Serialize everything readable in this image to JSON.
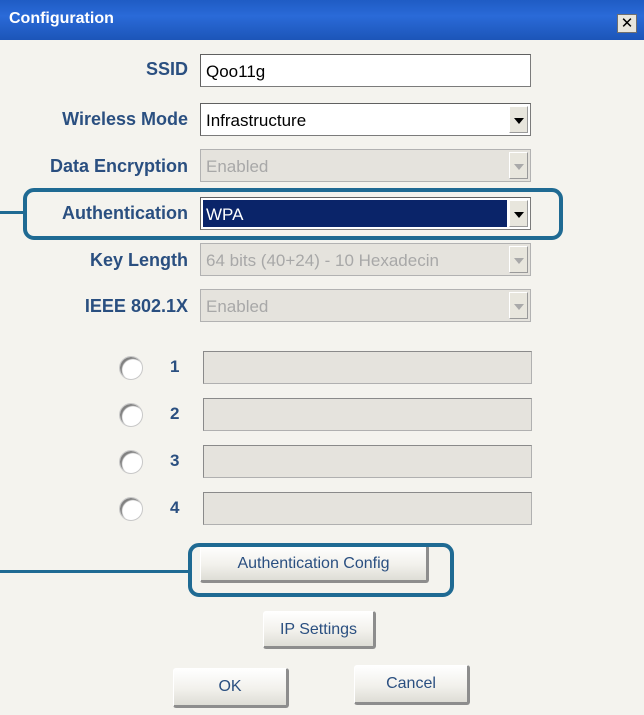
{
  "window": {
    "title": "Configuration",
    "close_glyph": "✕"
  },
  "form": {
    "ssid": {
      "label": "SSID",
      "value": "Qoo11g"
    },
    "wireless_mode": {
      "label": "Wireless Mode",
      "value": "Infrastructure"
    },
    "data_encryption": {
      "label": "Data Encryption",
      "value": "Enabled"
    },
    "authentication": {
      "label": "Authentication",
      "value": "WPA"
    },
    "key_length": {
      "label": "Key Length",
      "value": "64 bits (40+24) - 10 Hexadecin"
    },
    "ieee_8021x": {
      "label": "IEEE 802.1X",
      "value": "Enabled"
    }
  },
  "keys": [
    {
      "number": "1",
      "value": ""
    },
    {
      "number": "2",
      "value": ""
    },
    {
      "number": "3",
      "value": ""
    },
    {
      "number": "4",
      "value": ""
    }
  ],
  "buttons": {
    "auth_config": "Authentication Config",
    "ip_settings": "IP Settings",
    "ok": "OK",
    "cancel": "Cancel"
  },
  "colors": {
    "titlebar": "#1f5cc4",
    "label": "#2a4f80",
    "selection": "#0a2469",
    "callout": "#1f6a93"
  }
}
